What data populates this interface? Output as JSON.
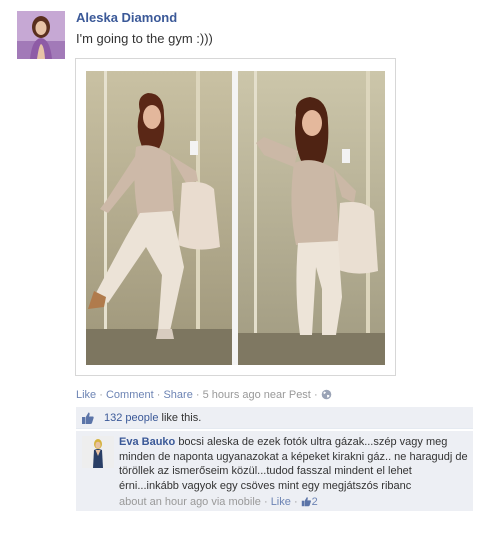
{
  "post": {
    "author": "Aleska Diamond",
    "status_text": "I'm going to the gym :)))",
    "actions": {
      "like": "Like",
      "comment": "Comment",
      "share": "Share",
      "time": "5 hours ago near Pest",
      "separator": "·"
    }
  },
  "likes": {
    "count_link": "132 people",
    "suffix": " like this."
  },
  "comment": {
    "author": "Eva Bauko",
    "text": "bocsi aleska de ezek fotók ultra gázak...szép vagy meg minden de naponta ugyanazokat a képeket kirakni gáz.. ne haragudj de töröllek az ismerőseim közül...tudod fasszal mindent el lehet érni...inkább vagyok egy csöves mint egy megjátszós ribanc",
    "time": "about an hour ago via mobile",
    "like": "Like",
    "like_count": "2",
    "separator": "·"
  },
  "icons": {
    "post_avatar": "profile-photo",
    "comment_avatar": "profile-photo",
    "privacy": "globe-icon",
    "likes": "thumbs-up-icon",
    "comment_likes": "thumbs-up-icon"
  }
}
